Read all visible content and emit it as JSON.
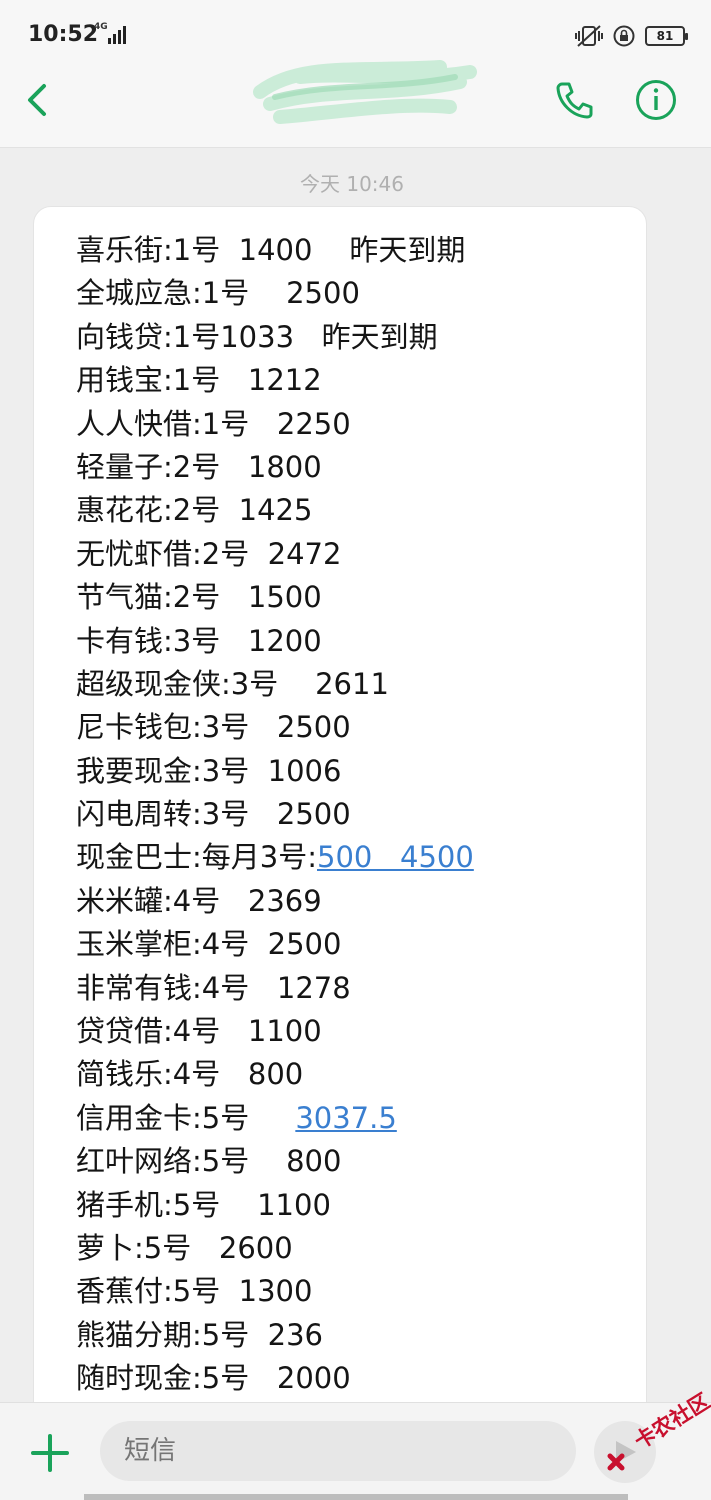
{
  "status_bar": {
    "time": "10:52",
    "network": "4G",
    "battery": "81"
  },
  "header": {
    "back_icon": "chevron-left-icon",
    "call_icon": "phone-icon",
    "info_icon": "info-icon"
  },
  "message": {
    "timestamp": "今天 10:46",
    "lines": [
      {
        "text": "喜乐街:1号  1400    昨天到期"
      },
      {
        "text": "全城应急:1号    2500"
      },
      {
        "text": "向钱贷:1号1033   昨天到期"
      },
      {
        "text": "用钱宝:1号   1212"
      },
      {
        "text": "人人快借:1号   2250"
      },
      {
        "text": "轻量子:2号   1800"
      },
      {
        "text": "惠花花:2号  1425"
      },
      {
        "text": "无忧虾借:2号  2472"
      },
      {
        "text": "节气猫:2号   1500"
      },
      {
        "text": "卡有钱:3号   1200"
      },
      {
        "text": "超级现金侠:3号    2611"
      },
      {
        "text": "尼卡钱包:3号   2500"
      },
      {
        "text": "我要现金:3号  1006"
      },
      {
        "text": "闪电周转:3号   2500"
      },
      {
        "text": "现金巴士:每月3号:",
        "link": "500   4500"
      },
      {
        "text": "米米罐:4号   2369"
      },
      {
        "text": "玉米掌柜:4号  2500"
      },
      {
        "text": "非常有钱:4号   1278"
      },
      {
        "text": "贷贷借:4号   1100"
      },
      {
        "text": "简钱乐:4号   800"
      },
      {
        "text": "信用金卡:5号     ",
        "link": "3037.5"
      },
      {
        "text": "红叶网络:5号    800"
      },
      {
        "text": "猪手机:5号    1100"
      },
      {
        "text": "萝卜:5号   2600"
      },
      {
        "text": "香蕉付:5号  1300"
      },
      {
        "text": "熊猫分期:5号  236"
      },
      {
        "text": "随时现金:5号   2000"
      }
    ]
  },
  "compose": {
    "placeholder": "短信",
    "add_icon": "plus-icon",
    "send_icon": "send-icon"
  },
  "watermark": {
    "text": "卡农社区"
  },
  "colors": {
    "accent": "#1aa35a",
    "link": "#3a7fd0",
    "bubble": "#ffffff",
    "background": "#eeeeee"
  }
}
